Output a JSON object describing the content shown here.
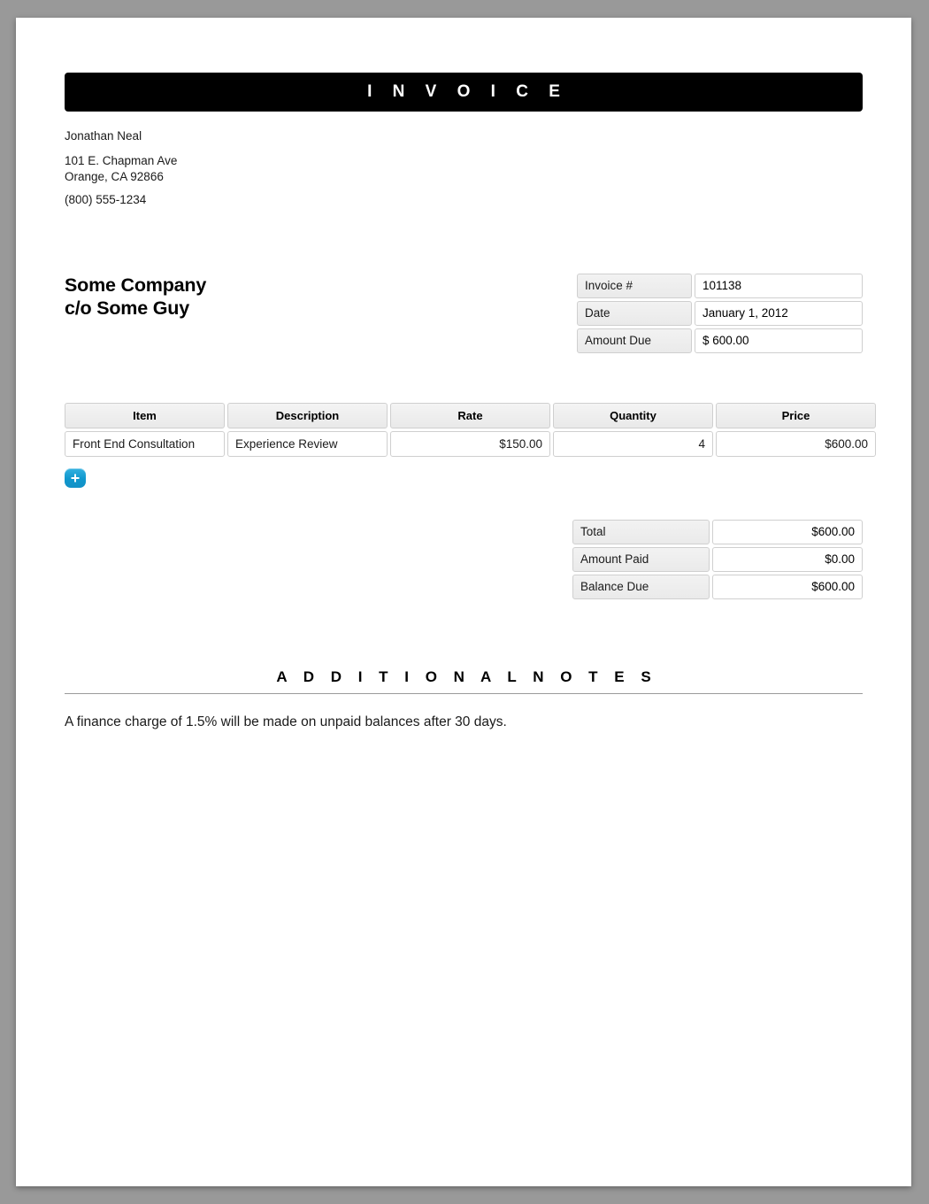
{
  "page": {
    "background_color": "#999999",
    "sheet_color": "#ffffff"
  },
  "banner": {
    "title": "I N V O I C E",
    "background_color": "#000000",
    "text_color": "#ffffff"
  },
  "sender": {
    "name": "Jonathan Neal",
    "address_line1": "101 E. Chapman Ave",
    "address_line2": "Orange, CA 92866",
    "phone": "(800) 555-1234"
  },
  "bill_to": {
    "line1": "Some Company",
    "line2": "c/o Some Guy"
  },
  "meta": {
    "rows": [
      {
        "label": "Invoice #",
        "value": "101138"
      },
      {
        "label": "Date",
        "value": "January 1, 2012"
      },
      {
        "label": "Amount Due",
        "value": "$  600.00"
      }
    ]
  },
  "items_table": {
    "columns": [
      "Item",
      "Description",
      "Rate",
      "Quantity",
      "Price"
    ],
    "rows": [
      {
        "item": "Front End Consultation",
        "description": "Experience Review",
        "rate": "$150.00",
        "quantity": "4",
        "price": "$600.00"
      }
    ],
    "add_row_button": {
      "label": "+",
      "icon": "plus-icon",
      "accent_color": "#1391c6"
    }
  },
  "totals": {
    "rows": [
      {
        "label": "Total",
        "value": "$600.00"
      },
      {
        "label": "Amount Paid",
        "value": "$0.00"
      },
      {
        "label": "Balance Due",
        "value": "$600.00"
      }
    ]
  },
  "notes": {
    "heading": "A D D I T I O N A L   N O T E S",
    "body": "A finance charge of 1.5% will be made on unpaid balances after 30 days."
  }
}
